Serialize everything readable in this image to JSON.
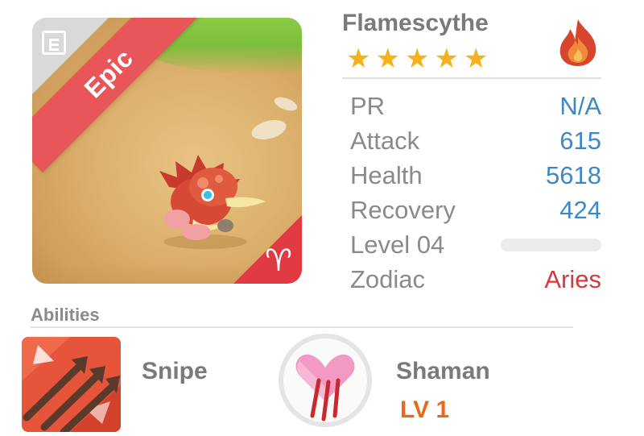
{
  "card": {
    "rarity": "Epic",
    "zodiac_symbol": "♈",
    "zodiac_color": "#e03b42"
  },
  "monster": {
    "name": "Flamescythe",
    "stars": 5,
    "element": "fire-icon"
  },
  "stats": [
    {
      "label": "PR",
      "value": "N/A"
    },
    {
      "label": "Attack",
      "value": "615"
    },
    {
      "label": "Health",
      "value": "5618"
    },
    {
      "label": "Recovery",
      "value": "424"
    }
  ],
  "level": {
    "label": "Level 04",
    "progress": 0
  },
  "zodiac": {
    "label": "Zodiac",
    "value": "Aries"
  },
  "abilities": {
    "title": "Abilities",
    "items": [
      {
        "name": "Snipe",
        "icon": "arrows-icon"
      },
      {
        "name": "Shaman",
        "icon": "heart-claw-icon",
        "level": "LV 1"
      }
    ]
  },
  "colors": {
    "value_blue": "#3f88c6",
    "aries_red": "#d5393a",
    "ribbon_red": "#e8565a",
    "star_gold": "#f6b21c",
    "level_orange": "#e8681d"
  }
}
